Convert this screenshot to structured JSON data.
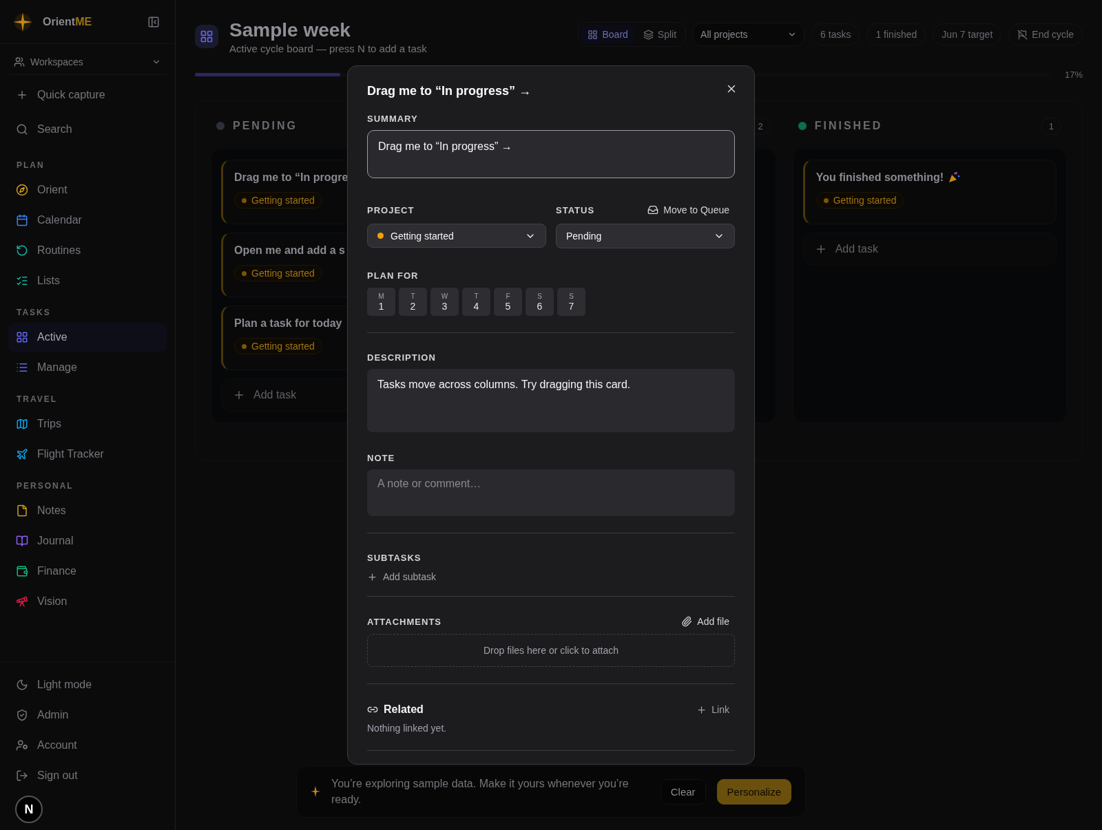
{
  "sidebar": {
    "brand": {
      "name": "Orient",
      "accent": "ME"
    },
    "workspace": {
      "label": "Workspaces"
    },
    "actions": [
      {
        "label": "Quick capture"
      },
      {
        "label": "Search"
      }
    ],
    "sections": [
      {
        "title": "PLAN",
        "items": [
          {
            "label": "Orient",
            "selected": false
          },
          {
            "label": "Calendar",
            "selected": false
          },
          {
            "label": "Routines",
            "selected": false
          },
          {
            "label": "Lists",
            "selected": false
          }
        ]
      },
      {
        "title": "TASKS",
        "items": [
          {
            "label": "Active",
            "selected": true
          },
          {
            "label": "Manage",
            "selected": false
          }
        ]
      },
      {
        "title": "TRAVEL",
        "items": [
          {
            "label": "Trips",
            "selected": false
          },
          {
            "label": "Flight Tracker",
            "selected": false
          }
        ]
      },
      {
        "title": "PERSONAL",
        "items": [
          {
            "label": "Notes",
            "selected": false
          },
          {
            "label": "Journal",
            "selected": false
          },
          {
            "label": "Finance",
            "selected": false
          },
          {
            "label": "Vision",
            "selected": false
          }
        ]
      }
    ],
    "footer": [
      {
        "label": "Light mode"
      },
      {
        "label": "Admin"
      },
      {
        "label": "Account"
      },
      {
        "label": "Sign out"
      }
    ]
  },
  "dev_badge": "N",
  "header": {
    "title": "Sample week",
    "subtitle": "Active cycle board — press N to add a task",
    "views": [
      {
        "label": "Board",
        "selected": true
      },
      {
        "label": "Split",
        "selected": false
      }
    ],
    "project_filter": "All projects",
    "stats": [
      "6 tasks",
      "1 finished",
      "Jun 7 target"
    ],
    "end_button": "End cycle",
    "progress": {
      "level": 0.17,
      "reading": "17%"
    }
  },
  "board": {
    "columns": [
      {
        "title": "PENDING",
        "color": "#2b303b",
        "cards": [
          {
            "title": "Drag me to “In progre",
            "project": "Getting started"
          },
          {
            "title": "Open me and add a s",
            "project": "Getting started"
          },
          {
            "title": "Plan a task for today",
            "project": "Getting started"
          }
        ],
        "add_label": "Add task"
      },
      {
        "count": "2"
      },
      {
        "title": "FINISHED",
        "color": "#0b6e50",
        "count": "1",
        "cards": [
          {
            "title": "You finished something!",
            "project": "Getting started",
            "celebration": true
          }
        ],
        "add_label": "Add task"
      }
    ]
  },
  "modal": {
    "title": "Drag me to “In progress” →",
    "summary": {
      "label": "SUMMARY",
      "value": "Drag me to “In progress” →"
    },
    "project": {
      "label": "PROJECT",
      "value": "Getting started"
    },
    "status": {
      "label": "STATUS",
      "value": "Pending",
      "queue_action": "Move to Queue"
    },
    "plan": {
      "label": "PLAN FOR",
      "days": [
        {
          "letter": "M",
          "date": "1"
        },
        {
          "letter": "T",
          "date": "2"
        },
        {
          "letter": "W",
          "date": "3"
        },
        {
          "letter": "T",
          "date": "4"
        },
        {
          "letter": "F",
          "date": "5"
        },
        {
          "letter": "S",
          "date": "6"
        },
        {
          "letter": "S",
          "date": "7"
        }
      ]
    },
    "description": {
      "label": "DESCRIPTION",
      "value": "Tasks move across columns. Try dragging this card."
    },
    "note": {
      "label": "NOTE",
      "placeholder": "A note or comment…"
    },
    "subtasks": {
      "label": "SUBTASKS",
      "add": "Add subtask"
    },
    "attachments": {
      "label": "ATTACHMENTS",
      "add": "Add file",
      "dropzone": "Drop files here or click to attach"
    },
    "related": {
      "label": "Related",
      "link": "Link",
      "empty": "Nothing linked yet."
    }
  },
  "banner": {
    "text": "You’re exploring sample data. Make it yours whenever you’re ready.",
    "buttons": [
      {
        "label": "Clear",
        "kind": "secondary"
      },
      {
        "label": "Personalize",
        "kind": "primary"
      }
    ]
  }
}
